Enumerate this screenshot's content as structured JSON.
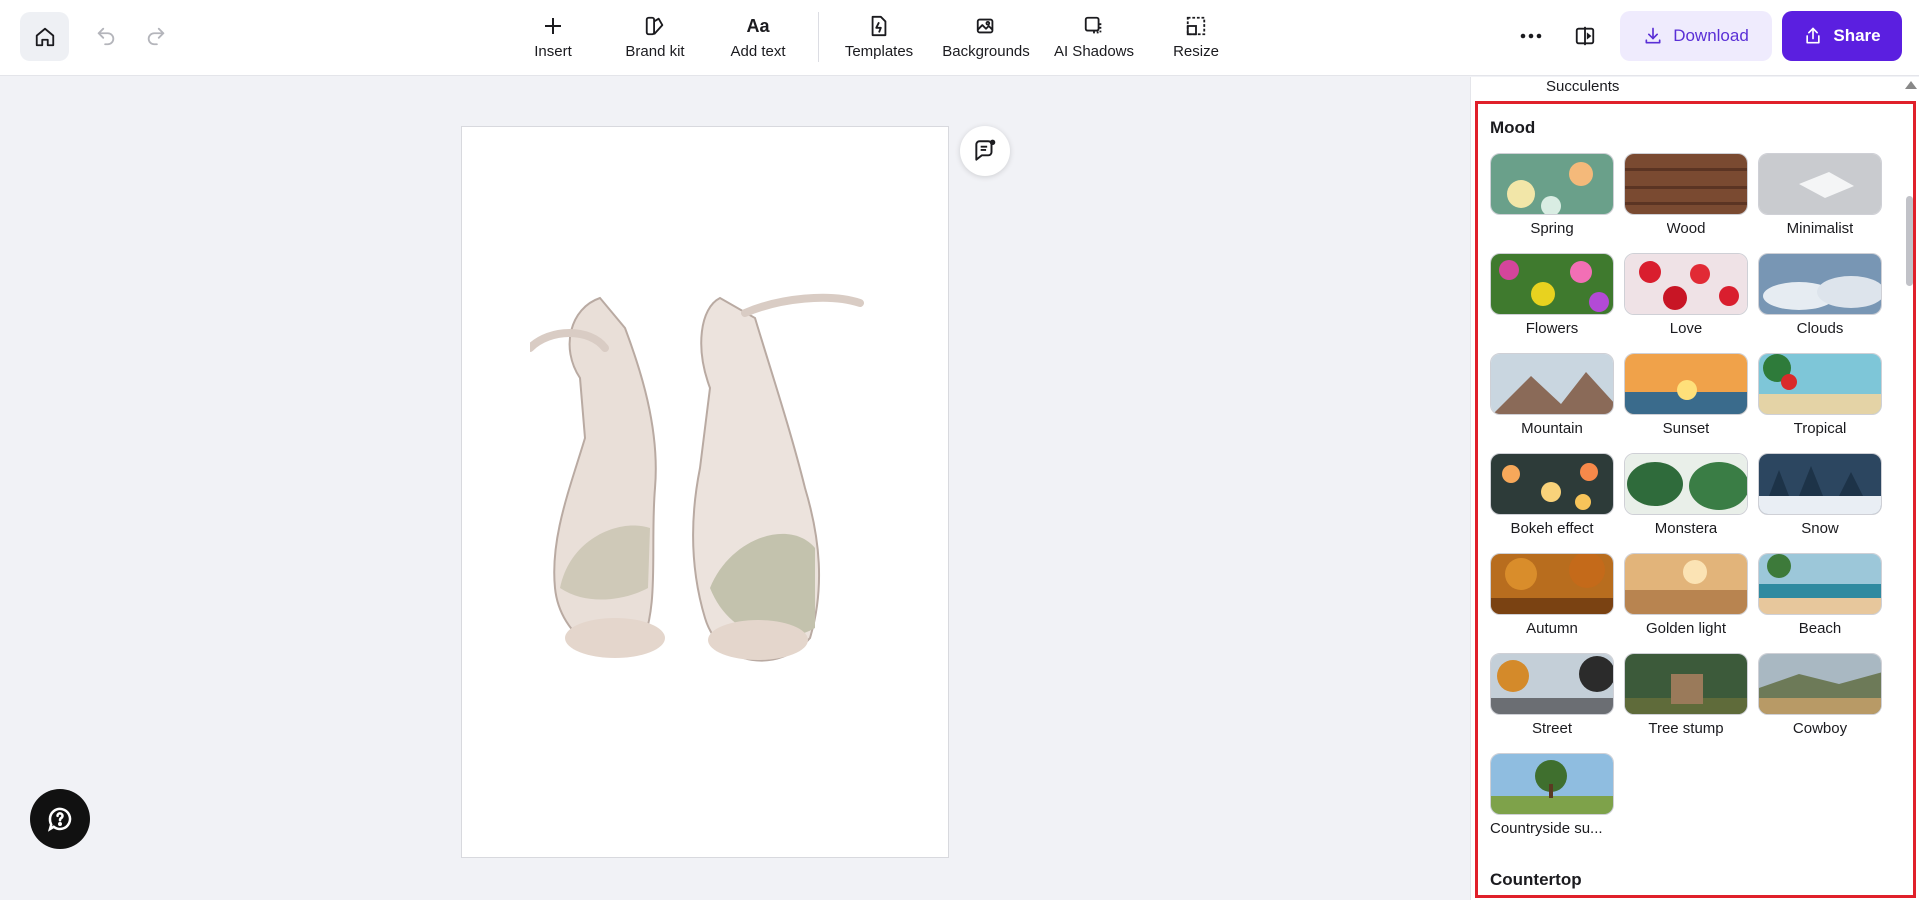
{
  "toolbar": {
    "tools": [
      {
        "label": "Insert",
        "icon": "plus-icon"
      },
      {
        "label": "Brand kit",
        "icon": "brand-kit-icon"
      },
      {
        "label": "Add text",
        "icon": "text-aa-icon",
        "glyph": "Aa"
      },
      {
        "label": "Templates",
        "icon": "templates-icon"
      },
      {
        "label": "Backgrounds",
        "icon": "backgrounds-icon"
      },
      {
        "label": "AI Shadows",
        "icon": "ai-shadows-icon"
      },
      {
        "label": "Resize",
        "icon": "resize-icon"
      }
    ],
    "download_label": "Download",
    "share_label": "Share"
  },
  "panel": {
    "prev_category_label": "Succulents",
    "section_title": "Mood",
    "next_section_title": "Countertop",
    "items": [
      {
        "label": "Spring"
      },
      {
        "label": "Wood"
      },
      {
        "label": "Minimalist"
      },
      {
        "label": "Flowers"
      },
      {
        "label": "Love"
      },
      {
        "label": "Clouds"
      },
      {
        "label": "Mountain"
      },
      {
        "label": "Sunset"
      },
      {
        "label": "Tropical"
      },
      {
        "label": "Bokeh effect"
      },
      {
        "label": "Monstera"
      },
      {
        "label": "Snow"
      },
      {
        "label": "Autumn"
      },
      {
        "label": "Golden light"
      },
      {
        "label": "Beach"
      },
      {
        "label": "Street"
      },
      {
        "label": "Tree stump"
      },
      {
        "label": "Cowboy"
      },
      {
        "label": "Countryside su..."
      }
    ]
  },
  "colors": {
    "accent": "#5b1fe0",
    "accent_light": "#efebfd",
    "highlight_border": "#e0202a"
  }
}
